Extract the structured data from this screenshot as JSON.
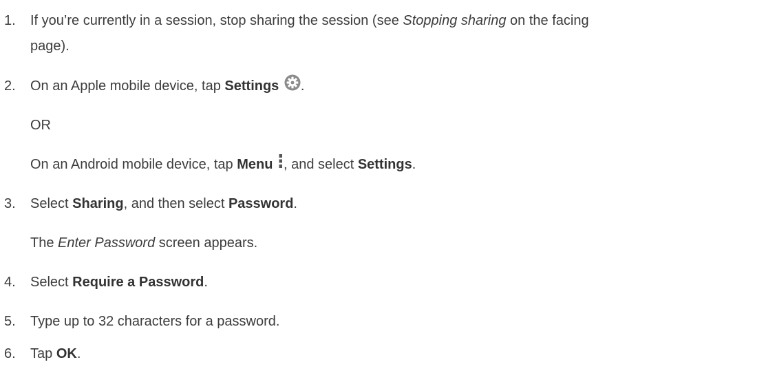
{
  "steps": [
    {
      "number": "1.",
      "line1_a": "If you’re currently in a session, stop sharing the session (see ",
      "line1_italic": "Stopping sharing",
      "line1_b": " on the facing",
      "line2": "page)."
    },
    {
      "number": "2.",
      "a": "On an Apple mobile device, tap ",
      "bold": "Settings",
      "icon": "gear-icon",
      "end": "."
    },
    {
      "or_text": "OR"
    },
    {
      "a": "On an Android mobile device, tap ",
      "bold1": "Menu",
      "icon": "menu-icon",
      "b": ", and select ",
      "bold2": "Settings",
      "end": "."
    },
    {
      "number": "3.",
      "a": "Select ",
      "bold1": "Sharing",
      "b": ", and then select ",
      "bold2": "Password",
      "end": "."
    },
    {
      "a": "The ",
      "italic": "Enter Password",
      "b": " screen appears."
    },
    {
      "number": "4.",
      "a": "Select ",
      "bold": "Require a Password",
      "end": "."
    },
    {
      "number": "5.",
      "a": "Type up to 32 characters for a password."
    },
    {
      "number": "6.",
      "a": "Tap ",
      "bold": "OK",
      "end": "."
    }
  ]
}
